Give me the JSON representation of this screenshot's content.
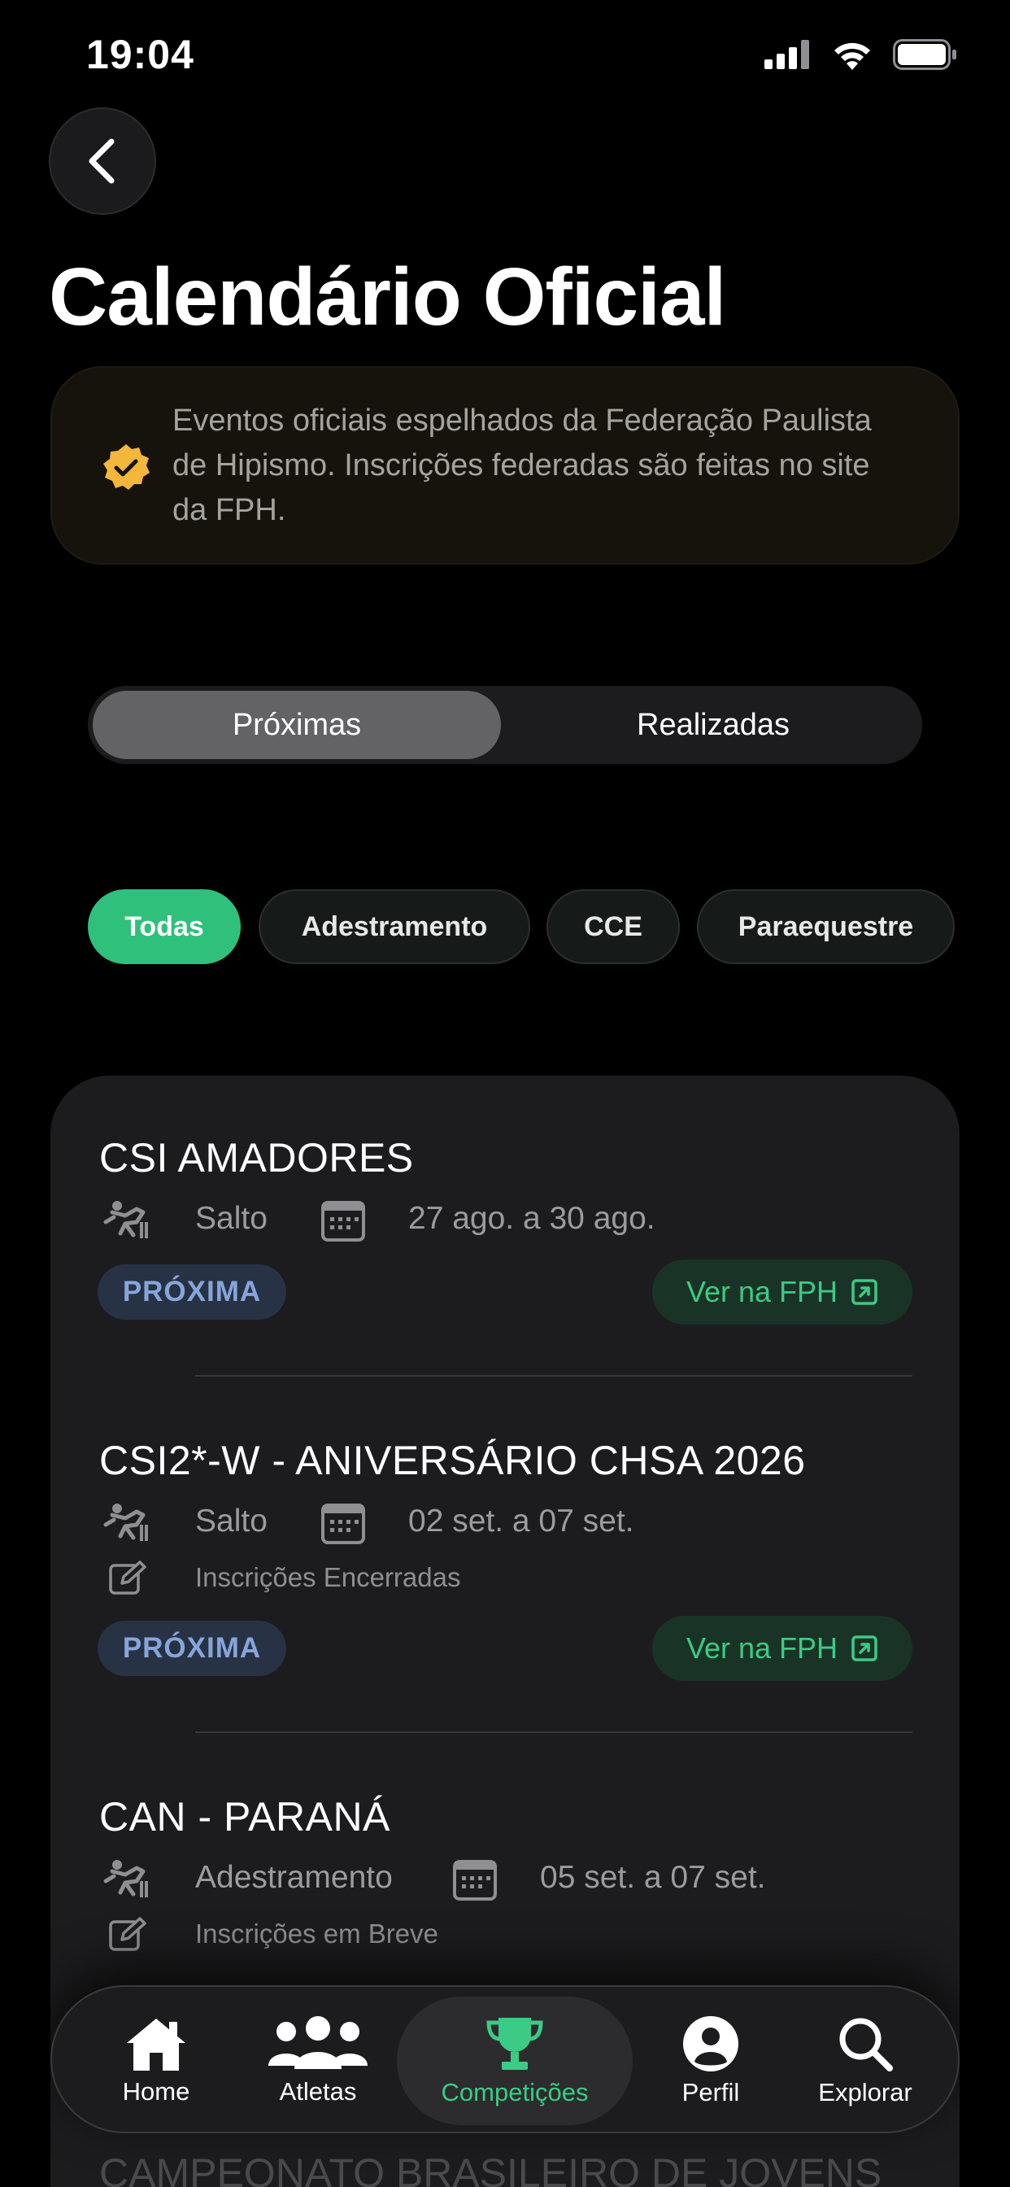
{
  "status": {
    "time": "19:04"
  },
  "page": {
    "title": "Calendário Oficial"
  },
  "banner": {
    "text": "Eventos oficiais espelhados da Federação Paulista de Hipismo. Inscrições federadas são feitas no site da FPH."
  },
  "segments": {
    "upcoming": "Próximas",
    "past": "Realizadas"
  },
  "filters": [
    "Todas",
    "Adestramento",
    "CCE",
    "Paraequestre"
  ],
  "events": [
    {
      "title": "CSI AMADORES",
      "discipline": "Salto",
      "dates": "27 ago. a 30 ago.",
      "registration": "",
      "badge": "PRÓXIMA",
      "link": "Ver na FPH"
    },
    {
      "title": "CSI2*-W - ANIVERSÁRIO CHSA 2026",
      "discipline": "Salto",
      "dates": "02 set. a 07 set.",
      "registration": "Inscrições Encerradas",
      "badge": "PRÓXIMA",
      "link": "Ver na FPH"
    },
    {
      "title": "CAN - PARANÁ",
      "discipline": "Adestramento",
      "dates": "05 set. a 07 set.",
      "registration": "Inscrições em Breve",
      "badge": "",
      "link": ""
    }
  ],
  "partial_event_title": "CAMPEONATO BRASILEIRO DE JOVENS",
  "tabs": [
    {
      "label": "Home",
      "icon": "home-icon"
    },
    {
      "label": "Atletas",
      "icon": "people-icon"
    },
    {
      "label": "Competições",
      "icon": "trophy-icon",
      "active": true
    },
    {
      "label": "Perfil",
      "icon": "person-icon"
    },
    {
      "label": "Explorar",
      "icon": "search-icon"
    }
  ],
  "colors": {
    "accent": "#2fc07b",
    "badge_text": "#86a6da",
    "banner_icon": "#f4b63b"
  }
}
